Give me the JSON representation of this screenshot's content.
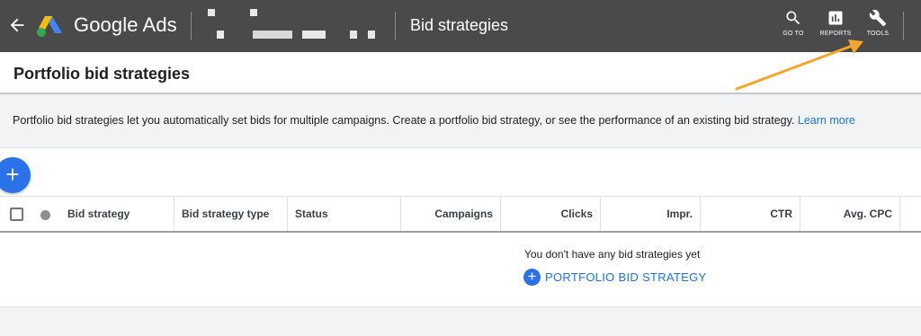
{
  "topbar": {
    "brand": "Google Ads",
    "page_title": "Bid strategies",
    "tools": [
      {
        "label": "GO TO"
      },
      {
        "label": "REPORTS"
      },
      {
        "label": "TOOLS"
      }
    ]
  },
  "header": {
    "title": "Portfolio bid strategies"
  },
  "description": {
    "text": "Portfolio bid strategies let you automatically set bids for multiple campaigns. Create a portfolio bid strategy, or see the performance of an existing bid strategy.",
    "link": "Learn more"
  },
  "fab": {
    "label": "+"
  },
  "table": {
    "columns": [
      "Bid strategy",
      "Bid strategy type",
      "Status",
      "Campaigns",
      "Clicks",
      "Impr.",
      "CTR",
      "Avg. CPC"
    ],
    "empty_message": "You don't have any bid strategies yet",
    "add_label": "PORTFOLIO BID STRATEGY"
  },
  "colors": {
    "topbar": "#4a4a4a",
    "accent": "#1a73e8",
    "annotation_arrow": "#f6a52b"
  }
}
